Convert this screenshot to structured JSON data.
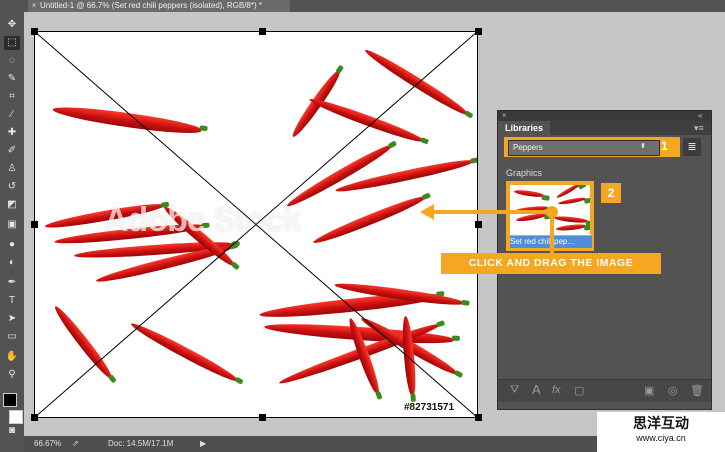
{
  "document_tab": {
    "title": "Untitled-1 @ 66.7% (Set red chili peppers (isolated), RGB/8*) *"
  },
  "toolbar": {
    "icons": [
      "move-icon",
      "marquee-icon",
      "lasso-icon",
      "quick-select-icon",
      "crop-icon",
      "eyedropper-icon",
      "healing-icon",
      "brush-icon",
      "stamp-icon",
      "history-brush-icon",
      "eraser-icon",
      "gradient-icon",
      "blur-icon",
      "dodge-icon",
      "pen-icon",
      "type-icon",
      "path-select-icon",
      "shape-icon",
      "hand-icon",
      "zoom-icon"
    ]
  },
  "canvas": {
    "watermark": "Adobe Stock",
    "stock_id": "#82731571"
  },
  "statusbar": {
    "zoom": "66.67%",
    "doc": "Doc: 14.5M/17.1M"
  },
  "libraries": {
    "close_label": "×",
    "collapse_label": "«",
    "tab_label": "Libraries",
    "menu_label": "≡",
    "selected_library": "Peppers",
    "badge1": "1",
    "section_label": "Graphics",
    "thumb_caption": "Set red chili pep...",
    "badge2": "2"
  },
  "callout": {
    "text": "CLICK AND DRAG THE IMAGE"
  },
  "brand": {
    "chinese": "思洋互动",
    "url": "www.ciya.cn"
  },
  "colors": {
    "accent": "#f5a623",
    "selection": "#4d8fd6",
    "panel": "#535353"
  }
}
